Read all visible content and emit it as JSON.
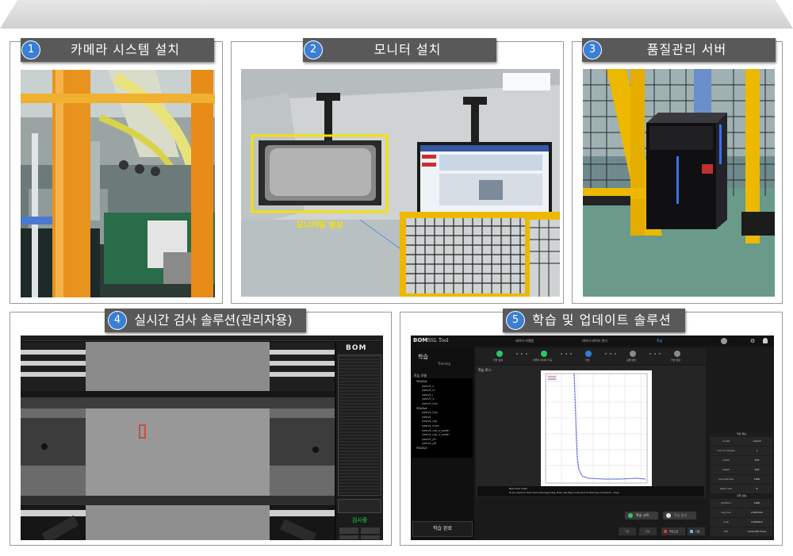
{
  "panels": {
    "camera": {
      "number": "1",
      "title": "카메라 시스템 설치"
    },
    "monitor": {
      "number": "2",
      "title": "모니터 설치",
      "annotation": "모니터링 영상"
    },
    "server": {
      "number": "3",
      "title": "품질관리 서버"
    },
    "inspection": {
      "number": "4",
      "title": "실시간 검사 솔루션(관리자용)",
      "brand": "BOM",
      "status_button": "검사중"
    },
    "training": {
      "number": "5",
      "title": "학습 및 업데이트 솔루션",
      "brand": "BOM",
      "app_name": "SSL Tool",
      "sidebar_title": "학습",
      "sidebar_subtitle": "Training",
      "model_section": "학습 모델",
      "model_tree": [
        "YOLOv5",
        "yolov5_s",
        "yolov5_m",
        "yolov5_l",
        "yolov5_x",
        "yolov5_tiny",
        "YOLOv4",
        "yolov4_tiny",
        "yolov4",
        "yolov4_csp",
        "yolov4_mish",
        "yolov4_csp_x_swish",
        "yolov4_csp_x_swish",
        "yolov4_p5",
        "yolov4_p6",
        "YOLOv3"
      ],
      "complete_button": "학습 완료",
      "top_tabs": [
        "데이터 라벨링",
        "데이터 데이터 관리",
        "학습"
      ],
      "steps": [
        "학습 설정",
        "어플리 데이터 가공",
        "학습",
        "모델 변환",
        "학습 완료"
      ],
      "log_title": "학습 로그",
      "console_lines": [
        "New best mAP!",
        "If you want to train from the beginning, then use flag in the end of training command: -clear"
      ],
      "start_button": "학습 시작",
      "stop_button": "학습 중지",
      "bottom_buttons": [
        "저장",
        "완료",
        "학습으로",
        "다음"
      ],
      "info_title": "학습 정보",
      "info_rows": [
        [
          "model",
          "yolov4"
        ],
        [
          "num of classes",
          "1"
        ],
        [
          "width",
          "416"
        ],
        [
          "height",
          "416"
        ],
        [
          "max batches",
          "1000"
        ],
        [
          "batch size",
          "8"
        ]
      ],
      "progress_title": "진행 상황",
      "progress_rows": [
        [
          "iteration",
          "1000"
        ],
        [
          "avg loss",
          "0.061324"
        ],
        [
          "map",
          "0.900013"
        ],
        [
          "ETA",
          "0.010156 hours"
        ]
      ]
    }
  }
}
